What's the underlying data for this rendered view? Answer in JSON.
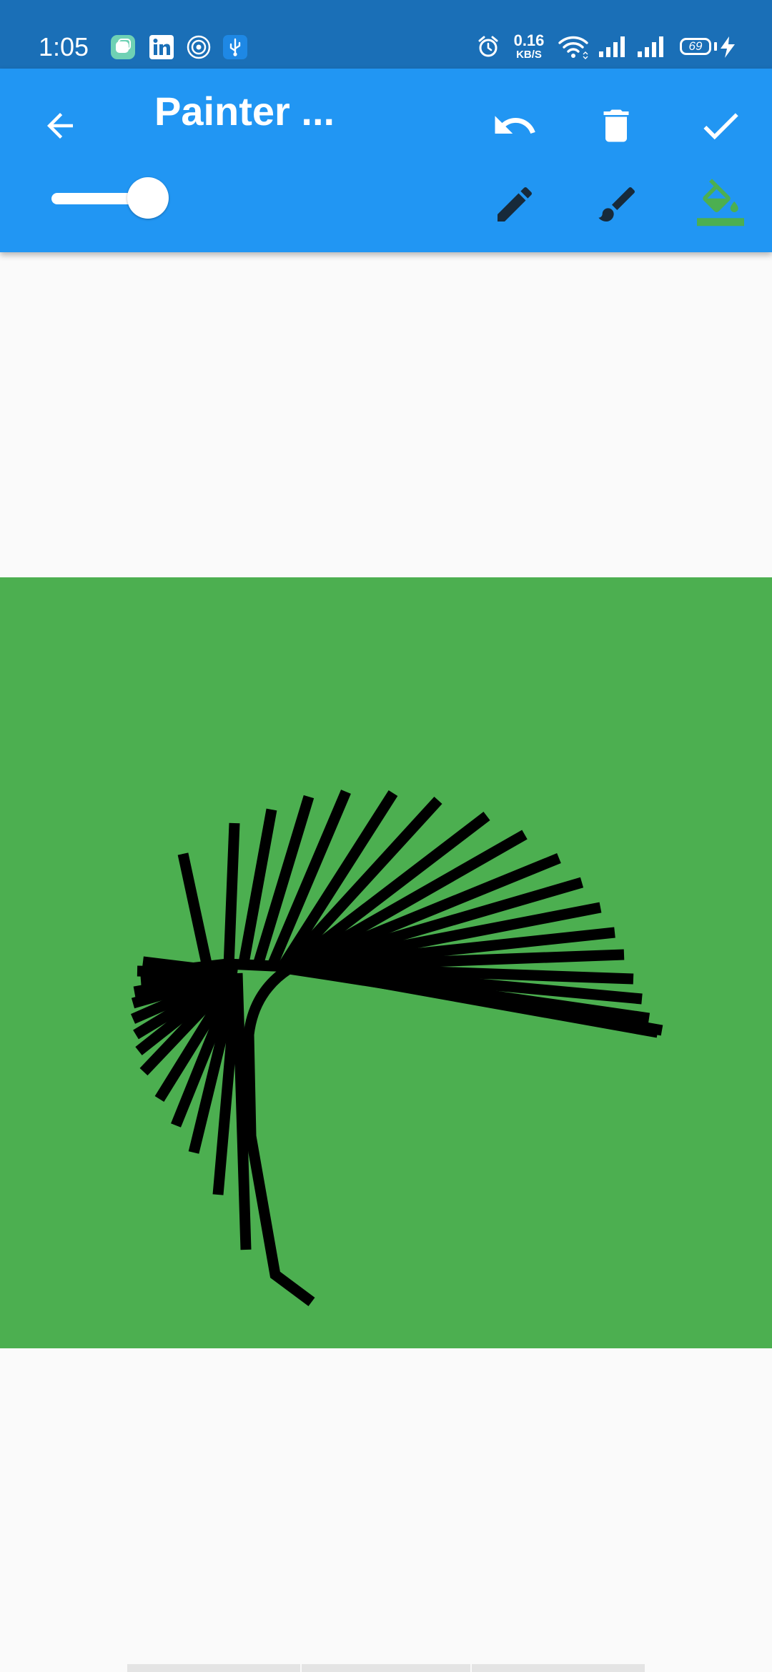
{
  "status_bar": {
    "time": "1:05",
    "net_speed_value": "0.16",
    "net_speed_unit": "KB/S",
    "battery_level": "69",
    "background": "#1A6FB7"
  },
  "app_bar": {
    "title": "Painter ...",
    "background": "#2196F3",
    "actions": [
      {
        "icon": "undo-icon"
      },
      {
        "icon": "trash-icon"
      },
      {
        "icon": "check-icon"
      }
    ],
    "tools": [
      {
        "icon": "pencil-icon",
        "selected": false
      },
      {
        "icon": "brush-icon",
        "selected": false
      },
      {
        "icon": "paint-bucket-icon",
        "selected": true
      }
    ],
    "stroke_width_slider": {
      "value_fraction": 0.95
    }
  },
  "canvas": {
    "background_color": "#4CAF50",
    "stroke_color": "#000000"
  },
  "page": {
    "background": "#FAFAFA"
  }
}
